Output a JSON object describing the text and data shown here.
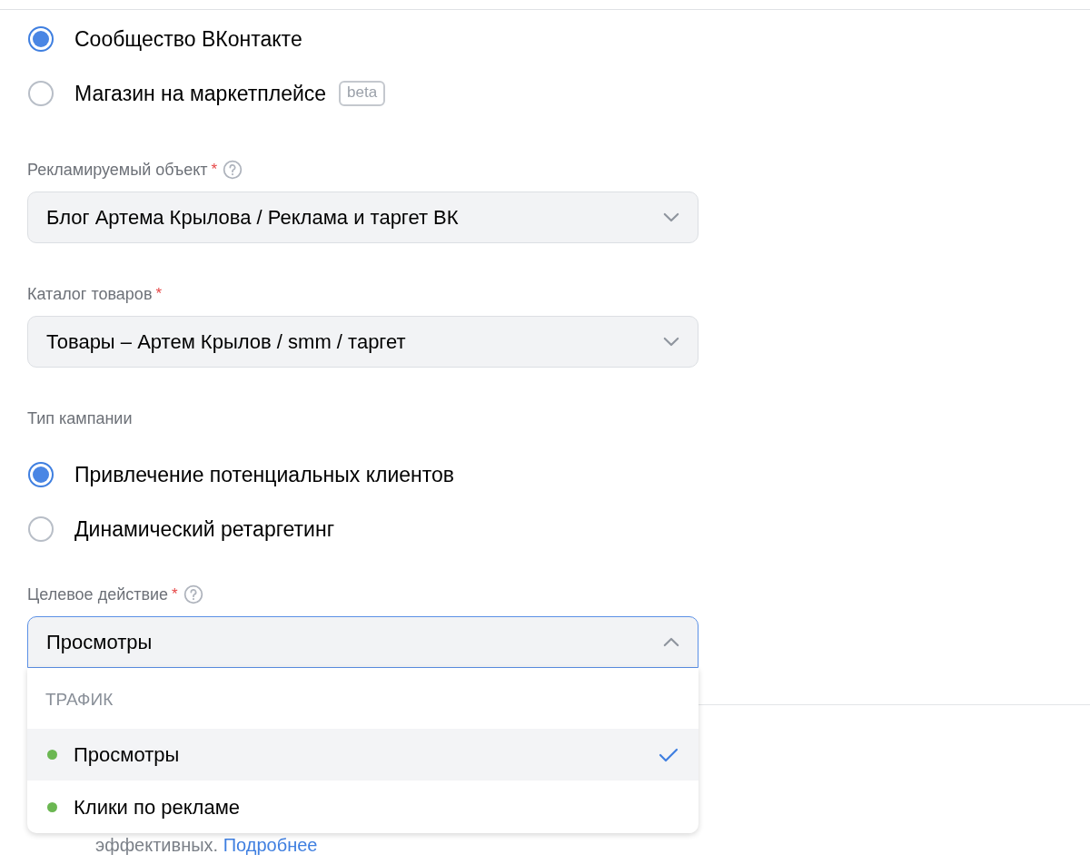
{
  "sources": [
    {
      "label": "Сообщество ВКонтакте",
      "selected": true
    },
    {
      "label": "Магазин на маркетплейсе",
      "selected": false,
      "badge": "beta"
    }
  ],
  "fields": [
    {
      "label": "Рекламируемый объект",
      "required_mark": "*",
      "help": true,
      "value": "Блог Артема Крылова / Реклама и таргет ВК"
    },
    {
      "label": "Каталог товаров",
      "required_mark": "*",
      "help": false,
      "value": "Товары – Артем Крылов / smm / таргет"
    }
  ],
  "campaign_type": {
    "label": "Тип кампании",
    "options": [
      {
        "label": "Привлечение потенциальных клиентов",
        "selected": true
      },
      {
        "label": "Динамический ретаргетинг",
        "selected": false
      }
    ]
  },
  "target_action": {
    "label": "Целевое действие",
    "required_mark": "*",
    "help": true,
    "value": "Просмотры",
    "expanded": true,
    "menu": {
      "group": "ТРАФИК",
      "items": [
        {
          "label": "Просмотры",
          "color": "#6bb752",
          "selected": true
        },
        {
          "label": "Клики по рекламе",
          "color": "#6bb752",
          "selected": false
        }
      ]
    }
  },
  "note": {
    "text": "эффективных.",
    "link": "Подробнее"
  }
}
